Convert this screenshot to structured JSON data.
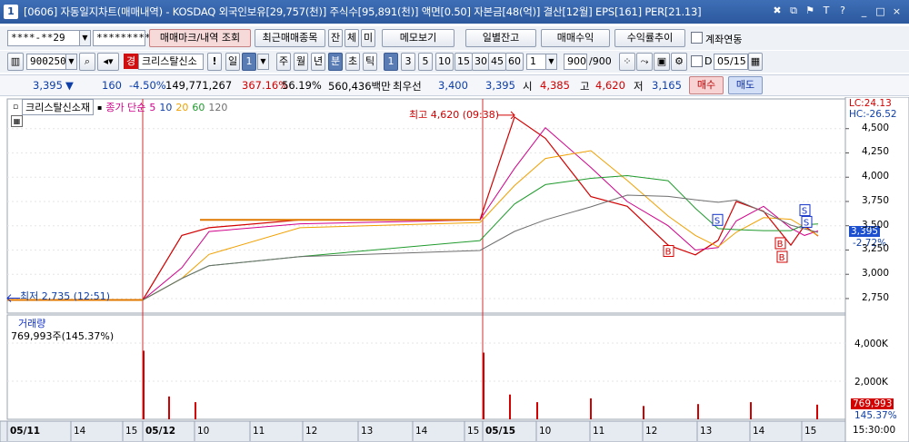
{
  "title_bar": {
    "window_number": "1",
    "title": "[0606] 자동일지차트(매매내역) - KOSDAQ 외국인보유[29,757(천)] 주식수[95,891(천)] 액면[0.50] 자본금[48(억)] 결산[12월] EPS[161] PER[21.13]",
    "title_icons": [
      "✖",
      "⧉",
      "⚑",
      "T",
      "?"
    ],
    "window_buttons": [
      "_",
      "□",
      "×"
    ]
  },
  "toolbar1": {
    "account_value": "****-**29",
    "password_value": "*********",
    "trade_mark_button": "매매마크/내역 조회",
    "recent_trades_button": "최근매매종목",
    "balance_button": "잔",
    "fill_button": "체",
    "unfilled_button": "미",
    "memo_button": "메모보기",
    "daily_balance_button": "일별잔고",
    "trade_profit_button": "매매수익",
    "return_trend_button": "수익률추이",
    "account_link_label": "계좌연동"
  },
  "toolbar2": {
    "code_value": "900250",
    "competition_badge": "경",
    "stock_name": "크리스탈신소",
    "period_day": "일",
    "period_count": "1",
    "period_week": "주",
    "period_month": "월",
    "period_year": "년",
    "period_minute": "분",
    "period_second": "초",
    "period_tick": "틱",
    "intervals": [
      "1",
      "3",
      "5",
      "10",
      "15",
      "30",
      "45",
      "60"
    ],
    "interval_count": "1",
    "view_count": "900",
    "view_total": "/900",
    "date_checkbox_label": "D",
    "date_value": "05/15"
  },
  "quote": {
    "price": "3,395",
    "change_arrow": "▼",
    "change": "160",
    "change_pct": "-4.50%",
    "volume": "149,771,267",
    "volume_ratio": "367.16%",
    "turnover": "56.19%",
    "amount": "560,436백만",
    "best_label": "최우선",
    "best_ask": "3,400",
    "best_bid": "3,395",
    "open_label": "시",
    "open": "4,385",
    "high_label": "고",
    "high": "4,620",
    "low_label": "저",
    "low": "3,165",
    "buy_button": "매수",
    "sell_button": "매도"
  },
  "price_panel": {
    "legend_name": "크리스탈신소재",
    "legend_series": "종가 단순",
    "ma_labels": [
      "5",
      "10",
      "20",
      "60",
      "120"
    ],
    "lc": "LC:24.13",
    "hc": "HC:-26.52",
    "high_annotation": "최고 4,620 (09:38)",
    "low_annotation": "최저 2,735 (12:51)",
    "last_price": "3,395",
    "last_change": "-2.72%",
    "y_ticks": [
      "4,500",
      "4,250",
      "4,000",
      "3,750",
      "3,500",
      "3,250",
      "3,000",
      "2,750"
    ]
  },
  "volume_panel": {
    "title": "거래량",
    "value": "769,993주(145.37%)",
    "last_value": "769,993",
    "last_pct": "145.37%",
    "y_ticks": [
      "4,000K",
      "2,000K"
    ]
  },
  "x_axis": {
    "labels": [
      "05/11",
      "14",
      "15",
      "05/12",
      "10",
      "11",
      "12",
      "13",
      "14",
      "15",
      "05/15",
      "10",
      "11",
      "12",
      "13",
      "14",
      "15"
    ],
    "time_readout": "15:30:00"
  },
  "colors": {
    "ma5": "#d0008a",
    "ma10": "#1e3cc8",
    "ma20": "#f0a000",
    "ma60": "#1f9a2c",
    "ma120": "#6e6e6e",
    "candle_up": "#d20000",
    "candle_down": "#1030c8"
  },
  "chart_data": {
    "type": "line",
    "period": "1분",
    "x": [
      "05/11 15:00",
      "05/12 09:00",
      "05/12 09:40",
      "05/12 10:10",
      "05/12 11:00",
      "05/15 09:00",
      "05/15 09:38",
      "05/15 10:00",
      "05/15 11:00",
      "05/15 11:30",
      "05/15 12:00",
      "05/15 12:40",
      "05/15 13:00",
      "05/15 13:40",
      "05/15 14:00",
      "05/15 14:30",
      "05/15 15:00",
      "05/15 15:20"
    ],
    "series": [
      {
        "name": "종가",
        "values": [
          2735,
          2735,
          3400,
          3480,
          3560,
          3560,
          4620,
          4400,
          3800,
          3700,
          3300,
          3200,
          3350,
          3750,
          3650,
          3300,
          3500,
          3395
        ]
      }
    ],
    "ylim": [
      2600,
      4750
    ],
    "y_ticks": [
      2750,
      3000,
      3250,
      3500,
      3750,
      4000,
      4250,
      4500
    ],
    "volume": {
      "name": "거래량",
      "x": [
        "05/12 09:00",
        "05/12 09:30",
        "05/12 10:00",
        "05/15 09:00",
        "05/15 09:30",
        "05/15 10:00",
        "05/15 11:00",
        "05/15 12:00",
        "05/15 13:00",
        "05/15 14:00",
        "05/15 15:00"
      ],
      "values": [
        3600000,
        1200000,
        900000,
        3500000,
        1300000,
        900000,
        1100000,
        700000,
        800000,
        900000,
        770000
      ],
      "ylim": [
        0,
        5000000
      ],
      "y_ticks": [
        2000000,
        4000000
      ]
    },
    "annotations": [
      "최고 4,620 (09:38)",
      "최저 2,735 (12:51)"
    ],
    "trade_markers": {
      "B": [
        "05/15 12:35",
        "05/15 13:20",
        "05/15 14:50",
        "05/15 14:55"
      ],
      "S": [
        "05/15 13:25",
        "05/15 15:00",
        "05/15 15:05"
      ]
    },
    "grid": true,
    "legend_position": "top-left"
  }
}
